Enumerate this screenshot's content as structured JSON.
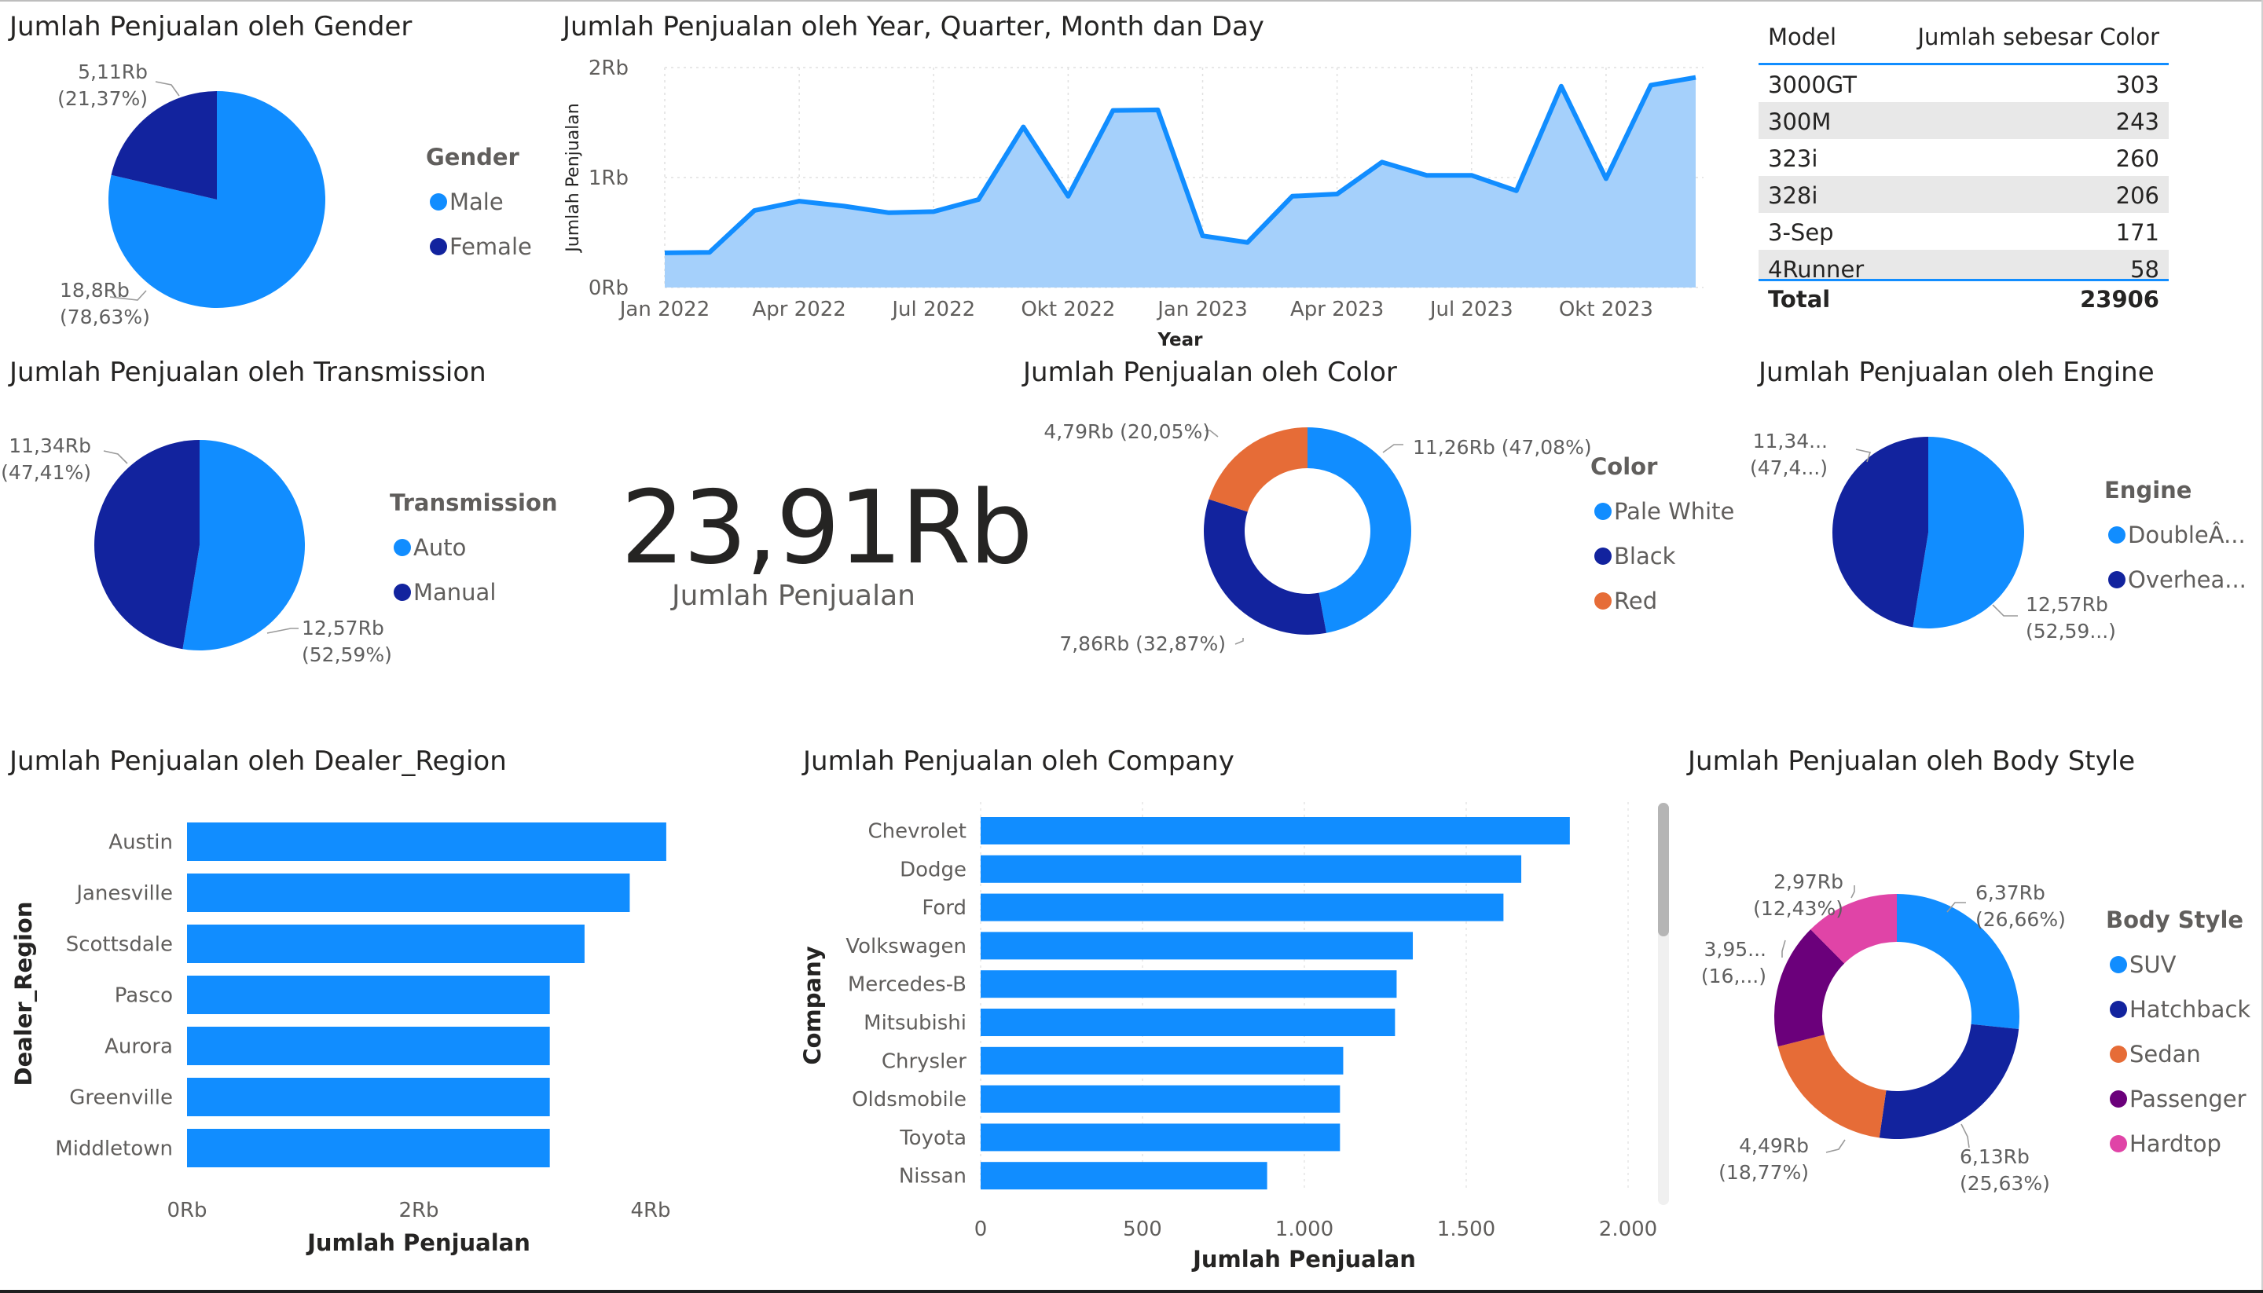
{
  "colors": {
    "blue": "#118dff",
    "navy": "#12239e",
    "orange": "#e66c37",
    "purple": "#6b007b",
    "pink": "#e044a7",
    "area_fill": "#a5d0fb",
    "accent": "#118dff"
  },
  "gender": {
    "title": "Jumlah Penjualan oleh Gender",
    "legend_title": "Gender",
    "legend": [
      "Male",
      "Female"
    ],
    "labels": [
      {
        "value": "18,8Rb",
        "pct": "(78,63%)"
      },
      {
        "value": "5,11Rb",
        "pct": "(21,37%)"
      }
    ],
    "chart_data": {
      "type": "pie",
      "categories": [
        "Male",
        "Female"
      ],
      "values": [
        18.8,
        5.11
      ],
      "percent": [
        78.63,
        21.37
      ],
      "unit": "Rb"
    }
  },
  "timeline": {
    "title": "Jumlah Penjualan oleh Year, Quarter, Month dan Day",
    "ylabel": "Jumlah Penjualan",
    "xlabel": "Year",
    "yticks": [
      "2Rb",
      "1Rb",
      "0Rb"
    ],
    "xticks": [
      "Jan 2022",
      "Apr 2022",
      "Jul 2022",
      "Okt 2022",
      "Jan 2023",
      "Apr 2023",
      "Jul 2023",
      "Okt 2023"
    ],
    "chart_data": {
      "type": "area",
      "x": [
        "Jan 2022",
        "Feb 2022",
        "Mar 2022",
        "Apr 2022",
        "May 2022",
        "Jun 2022",
        "Jul 2022",
        "Aug 2022",
        "Sep 2022",
        "Oct 2022",
        "Nov 2022",
        "Dec 2022",
        "Jan 2023",
        "Feb 2023",
        "Mar 2023",
        "Apr 2023",
        "May 2023",
        "Jun 2023",
        "Jul 2023",
        "Aug 2023",
        "Sep 2023",
        "Oct 2023",
        "Nov 2023",
        "Dec 2023"
      ],
      "values": [
        315,
        320,
        700,
        785,
        740,
        680,
        690,
        800,
        1460,
        830,
        1610,
        1615,
        470,
        410,
        830,
        850,
        1140,
        1020,
        1020,
        880,
        1830,
        990,
        1840,
        1910
      ],
      "ylim": [
        0,
        2000
      ]
    }
  },
  "table": {
    "headers": [
      "Model",
      "Jumlah sebesar Color"
    ],
    "rows": [
      [
        "3000GT",
        "303"
      ],
      [
        "300M",
        "243"
      ],
      [
        "323i",
        "260"
      ],
      [
        "328i",
        "206"
      ],
      [
        "3-Sep",
        "171"
      ],
      [
        "4Runner",
        "58"
      ]
    ],
    "total_label": "Total",
    "total_value": "23906"
  },
  "transmission": {
    "title": "Jumlah Penjualan oleh Transmission",
    "legend_title": "Transmission",
    "legend": [
      "Auto",
      "Manual"
    ],
    "labels": [
      {
        "value": "12,57Rb",
        "pct": "(52,59%)"
      },
      {
        "value": "11,34Rb",
        "pct": "(47,41%)"
      }
    ],
    "chart_data": {
      "type": "pie",
      "categories": [
        "Auto",
        "Manual"
      ],
      "values": [
        12.57,
        11.34
      ],
      "percent": [
        52.59,
        47.41
      ],
      "unit": "Rb"
    }
  },
  "kpi": {
    "value": "23,91Rb",
    "label": "Jumlah Penjualan"
  },
  "color": {
    "title": "Jumlah Penjualan oleh Color",
    "legend_title": "Color",
    "legend": [
      "Pale White",
      "Black",
      "Red"
    ],
    "labels": [
      "11,26Rb (47,08%)",
      "7,86Rb (32,87%)",
      "4,79Rb (20,05%)"
    ],
    "chart_data": {
      "type": "pie",
      "categories": [
        "Pale White",
        "Black",
        "Red"
      ],
      "values": [
        11.26,
        7.86,
        4.79
      ],
      "percent": [
        47.08,
        32.87,
        20.05
      ],
      "unit": "Rb"
    }
  },
  "engine": {
    "title": "Jumlah Penjualan oleh Engine",
    "legend_title": "Engine",
    "legend": [
      "DoubleÂ...",
      "Overhea..."
    ],
    "labels": [
      {
        "value": "12,57Rb",
        "pct": "(52,59...)"
      },
      {
        "value": "11,34...",
        "pct": "(47,4...)"
      }
    ],
    "chart_data": {
      "type": "pie",
      "categories": [
        "DoubleÂ...",
        "Overhea..."
      ],
      "values": [
        12.57,
        11.34
      ],
      "percent": [
        52.59,
        47.41
      ],
      "unit": "Rb"
    }
  },
  "region": {
    "title": "Jumlah Penjualan oleh Dealer_Region",
    "ylabel": "Dealer_Region",
    "xlabel": "Jumlah Penjualan",
    "xticks": [
      "0Rb",
      "2Rb",
      "4Rb"
    ],
    "chart_data": {
      "type": "bar",
      "categories": [
        "Austin",
        "Janesville",
        "Scottsdale",
        "Pasco",
        "Aurora",
        "Greenville",
        "Middletown"
      ],
      "values": [
        4135,
        3820,
        3430,
        3130,
        3130,
        3130,
        3130
      ],
      "xlim": [
        0,
        4000
      ]
    }
  },
  "company": {
    "title": "Jumlah Penjualan oleh Company",
    "ylabel": "Company",
    "xlabel": "Jumlah Penjualan",
    "xticks": [
      "0",
      "500",
      "1.000",
      "1.500",
      "2.000"
    ],
    "chart_data": {
      "type": "bar",
      "categories": [
        "Chevrolet",
        "Dodge",
        "Ford",
        "Volkswagen",
        "Mercedes-B",
        "Mitsubishi",
        "Chrysler",
        "Oldsmobile",
        "Toyota",
        "Nissan"
      ],
      "values": [
        1820,
        1670,
        1615,
        1335,
        1285,
        1280,
        1120,
        1110,
        1110,
        885
      ],
      "xlim": [
        0,
        2000
      ]
    }
  },
  "body": {
    "title": "Jumlah Penjualan oleh Body Style",
    "legend_title": "Body Style",
    "legend": [
      "SUV",
      "Hatchback",
      "Sedan",
      "Passenger",
      "Hardtop"
    ],
    "labels": [
      {
        "value": "6,37Rb",
        "pct": "(26,66%)"
      },
      {
        "value": "6,13Rb",
        "pct": "(25,63%)"
      },
      {
        "value": "4,49Rb",
        "pct": "(18,77%)"
      },
      {
        "value": "3,95...",
        "pct": "(16,...)"
      },
      {
        "value": "2,97Rb",
        "pct": "(12,43%)"
      }
    ],
    "chart_data": {
      "type": "pie",
      "categories": [
        "SUV",
        "Hatchback",
        "Sedan",
        "Passenger",
        "Hardtop"
      ],
      "values": [
        6.37,
        6.13,
        4.49,
        3.95,
        2.97
      ],
      "percent": [
        26.66,
        25.63,
        18.77,
        16.51,
        12.43
      ],
      "unit": "Rb"
    }
  }
}
